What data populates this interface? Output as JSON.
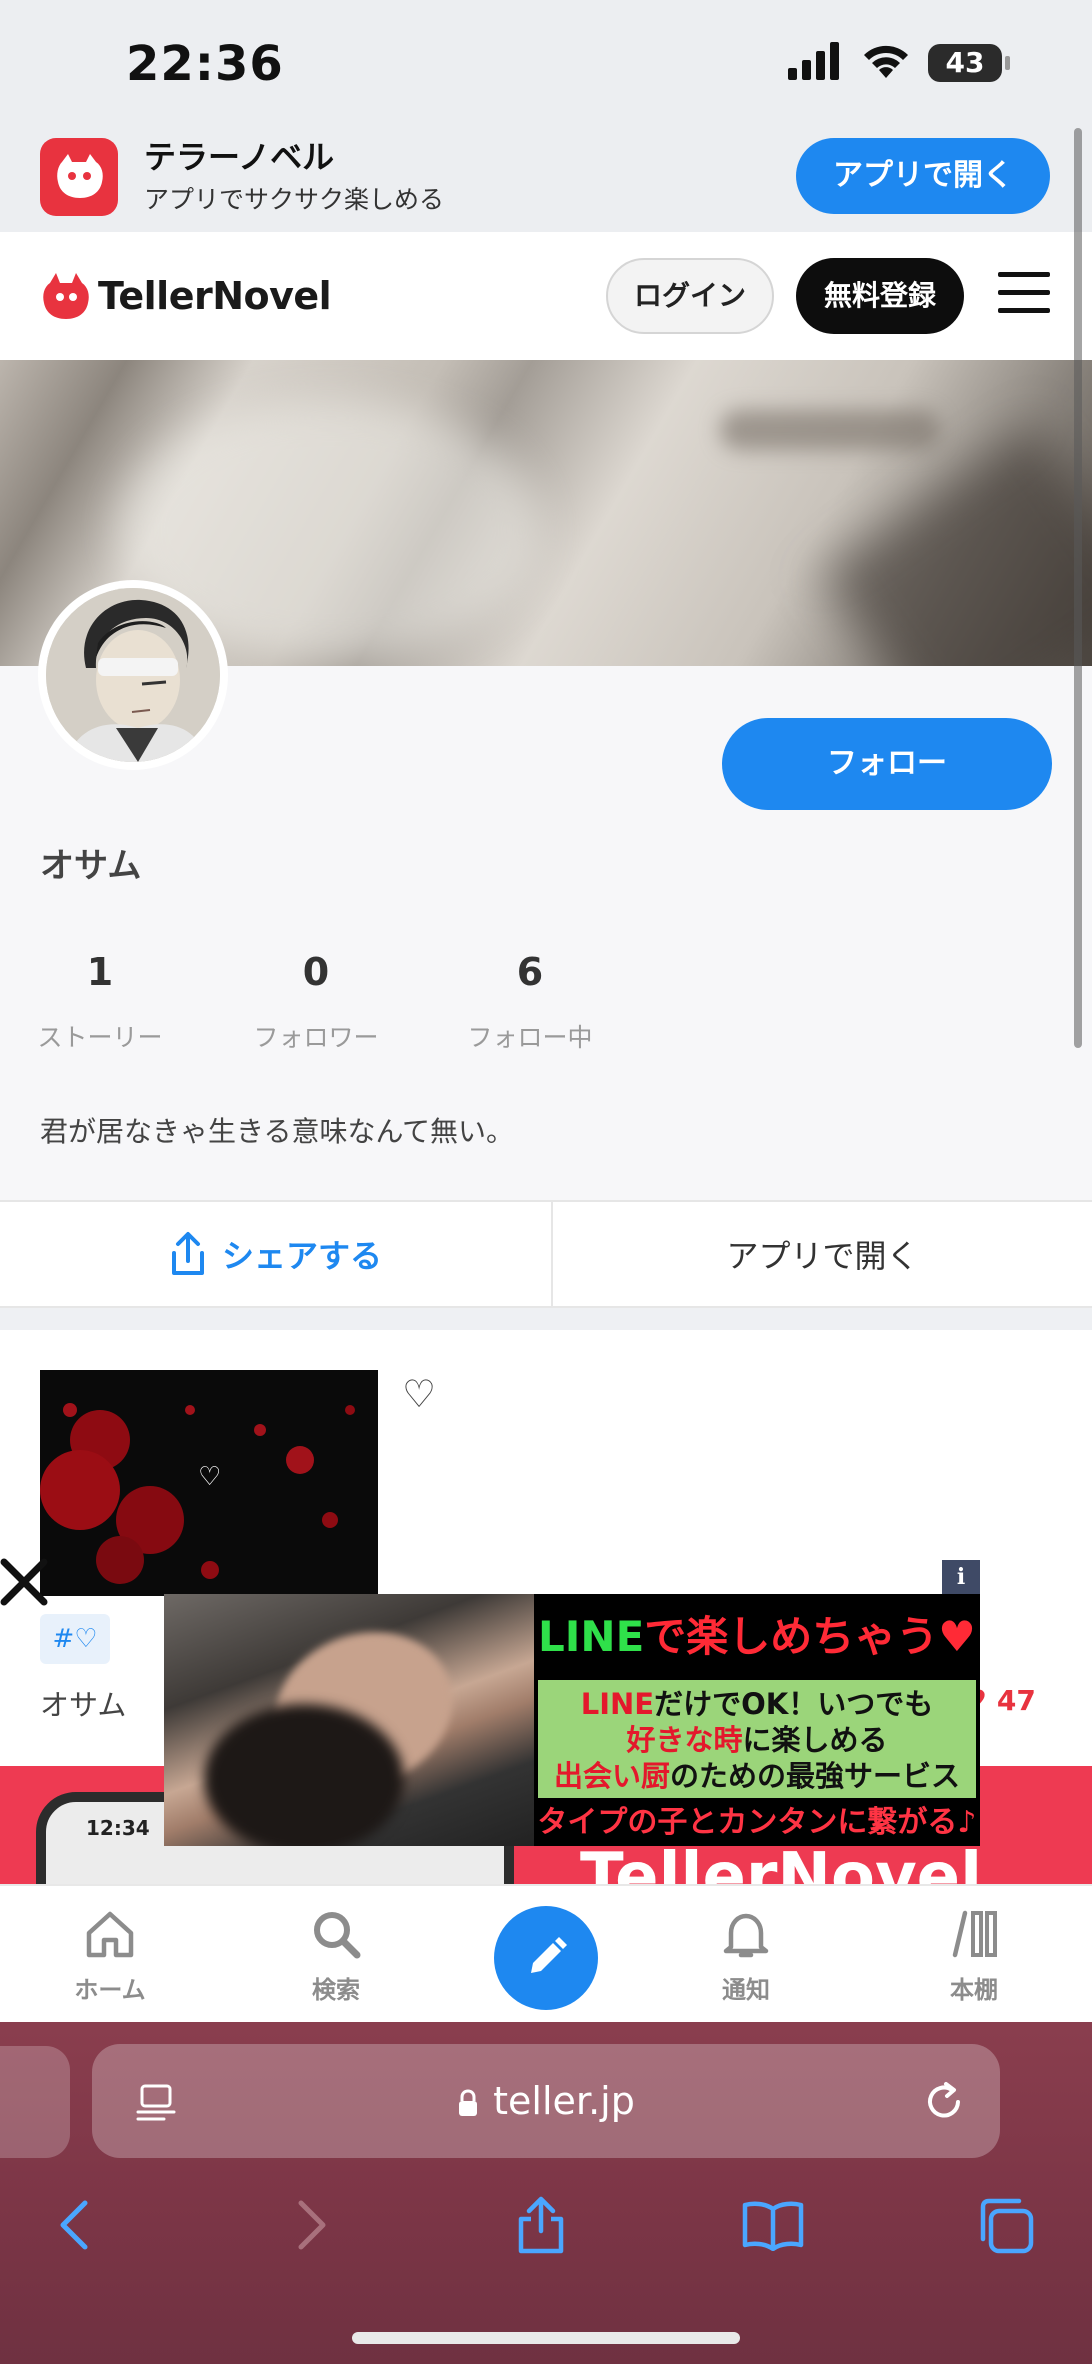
{
  "status_bar": {
    "time": "22:36",
    "battery": "43"
  },
  "app_banner": {
    "app_name": "テラーノベル",
    "subtitle": "アプリでサクサク楽しめる",
    "open_label": "アプリで開く"
  },
  "header": {
    "logo_text": "TellerNovel",
    "login_label": "ログイン",
    "signup_label": "無料登録"
  },
  "profile": {
    "username": "オサム",
    "follow_label": "フォロー",
    "stats": [
      {
        "value": "1",
        "label": "ストーリー"
      },
      {
        "value": "0",
        "label": "フォロワー"
      },
      {
        "value": "6",
        "label": "フォロー中"
      }
    ],
    "bio": "君が居なきゃ生きる意味なんて無い。"
  },
  "actions": {
    "share_label": "シェアする",
    "open_app_label": "アプリで開く"
  },
  "story": {
    "thumb_heart": "♡",
    "like_icon_text": "♡",
    "tag": "#♡",
    "author": "オサム",
    "likes": "47"
  },
  "promo": {
    "phone_time": "12:34",
    "logo_text": "TellerNovel"
  },
  "ad": {
    "info": "i",
    "head_green": "LINE",
    "head_red": "で楽しめちゃう♥",
    "line1_red": "LINE",
    "line1_rest": "だけでOK！いつでも",
    "line2_red": "好きな時",
    "line2_rest": "に楽しめる",
    "line3_red": "出会い厨",
    "line3_rest": "のための最強サービス",
    "foot": "タイプの子とカンタンに繋がる♪"
  },
  "bottom_nav": {
    "items": [
      {
        "label": "ホーム",
        "icon": "home-icon"
      },
      {
        "label": "検索",
        "icon": "search-icon"
      },
      {
        "label": "",
        "icon": "pencil-icon"
      },
      {
        "label": "通知",
        "icon": "bell-icon"
      },
      {
        "label": "本棚",
        "icon": "bookshelf-icon"
      }
    ]
  },
  "safari": {
    "url": "teller.jp"
  },
  "colors": {
    "accent": "#1e88f0",
    "brand_red": "#e8333f",
    "safari_tint": "#7d3647"
  }
}
